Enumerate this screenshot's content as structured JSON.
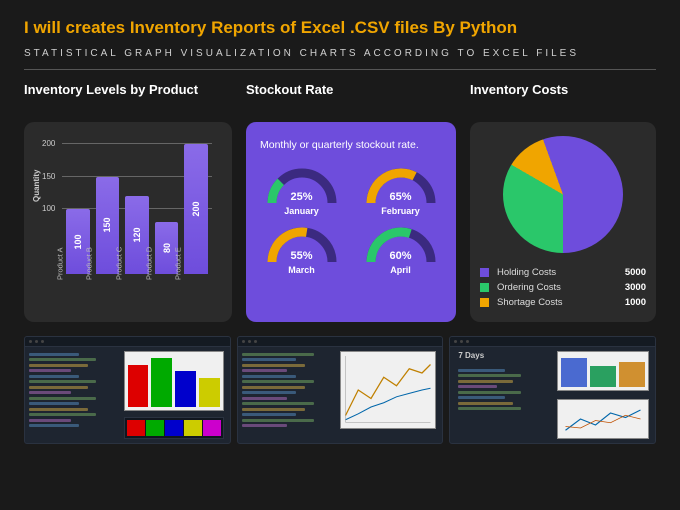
{
  "headline": "I will creates Inventory Reports of Excel .CSV files By Python",
  "subhead": "STATISTICAL GRAPH  VISUALIZATION CHARTS ACCORDING TO EXCEL FILES",
  "colors": {
    "accent": "#f0a500",
    "purple": "#6e4ddc",
    "green": "#2ac76a",
    "orange": "#f0a500"
  },
  "chart_data": [
    {
      "id": "inventory_levels",
      "type": "bar",
      "title": "Inventory Levels by Product",
      "ylabel": "Quantity",
      "yticks": [
        100,
        150,
        200
      ],
      "ylim": [
        0,
        210
      ],
      "categories": [
        "Product A",
        "Product B",
        "Product C",
        "Product D",
        "Product E"
      ],
      "values": [
        100,
        150,
        120,
        80,
        200
      ]
    },
    {
      "id": "stockout_rate",
      "type": "gauge-grid",
      "title": "Stockout Rate",
      "subtitle": "Monthly or quarterly stockout rate.",
      "items": [
        {
          "label": "January",
          "value": 25,
          "display": "25%",
          "color": "#2ac76a"
        },
        {
          "label": "February",
          "value": 65,
          "display": "65%",
          "color": "#f0a500"
        },
        {
          "label": "March",
          "value": 55,
          "display": "55%",
          "color": "#f0a500"
        },
        {
          "label": "April",
          "value": 60,
          "display": "60%",
          "color": "#2ac76a"
        }
      ]
    },
    {
      "id": "inventory_costs",
      "type": "pie",
      "title": "Inventory Costs",
      "series": [
        {
          "name": "Holding Costs",
          "value": 5000,
          "color": "#6e4ddc"
        },
        {
          "name": "Ordering Costs",
          "value": 3000,
          "color": "#2ac76a"
        },
        {
          "name": "Shortage Costs",
          "value": 1000,
          "color": "#f0a500"
        }
      ]
    }
  ],
  "bottom_strip": {
    "label": "7 Days"
  }
}
